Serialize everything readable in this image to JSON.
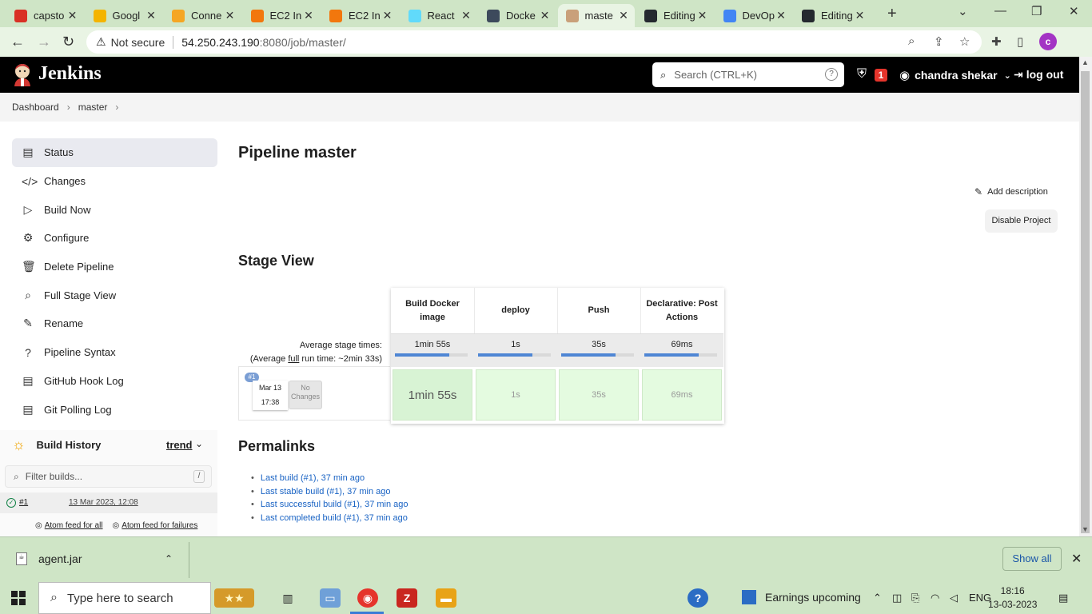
{
  "browser": {
    "tabs": [
      {
        "title": "capsto",
        "color": "#d93025",
        "letter": "M"
      },
      {
        "title": "Googl",
        "color": "#f4b400",
        "letter": ""
      },
      {
        "title": "Conne",
        "color": "#f5a623",
        "letter": ""
      },
      {
        "title": "EC2 In",
        "color": "#f2770d",
        "letter": ""
      },
      {
        "title": "EC2 In",
        "color": "#f2770d",
        "letter": ""
      },
      {
        "title": "React",
        "color": "#61dafb",
        "letter": ""
      },
      {
        "title": "Docke",
        "color": "#3d4a5c",
        "letter": ""
      },
      {
        "title": "maste",
        "color": "#c9a07a",
        "letter": ""
      },
      {
        "title": "Editing",
        "color": "#24292f",
        "letter": ""
      },
      {
        "title": "DevOp",
        "color": "#4285f4",
        "letter": ""
      },
      {
        "title": "Editing",
        "color": "#24292f",
        "letter": ""
      }
    ],
    "not_secure": "Not secure",
    "url_host": "54.250.243.190",
    "url_rest": ":8080/job/master/",
    "profile_letter": "c"
  },
  "jenkins": {
    "brand": "Jenkins",
    "search_placeholder": "Search (CTRL+K)",
    "security_count": "1",
    "user": "chandra shekar",
    "logout": "log out"
  },
  "breadcrumb": [
    "Dashboard",
    "master"
  ],
  "sidebar": {
    "items": [
      {
        "label": "Status",
        "icon": "file-icon"
      },
      {
        "label": "Changes",
        "icon": "code-icon"
      },
      {
        "label": "Build Now",
        "icon": "play-icon"
      },
      {
        "label": "Configure",
        "icon": "gear-icon"
      },
      {
        "label": "Delete Pipeline",
        "icon": "trash-icon"
      },
      {
        "label": "Full Stage View",
        "icon": "search-icon"
      },
      {
        "label": "Rename",
        "icon": "pencil-icon"
      },
      {
        "label": "Pipeline Syntax",
        "icon": "help-icon"
      },
      {
        "label": "GitHub Hook Log",
        "icon": "file-icon"
      },
      {
        "label": "Git Polling Log",
        "icon": "file-icon"
      }
    ]
  },
  "build_history": {
    "title": "Build History",
    "trend": "trend",
    "filter_placeholder": "Filter builds...",
    "filter_shortcut": "/",
    "builds": [
      {
        "num": "#1",
        "date": "13 Mar 2023, 12:08"
      }
    ],
    "feed_all": "Atom feed for all",
    "feed_failures": "Atom feed for failures"
  },
  "main": {
    "title": "Pipeline master",
    "add_description": "Add description",
    "disable_project": "Disable Project",
    "stage_view_title": "Stage View",
    "avg_stage_times": "Average stage times:",
    "avg_full_prefix": "(Average ",
    "avg_full_link": "full",
    "avg_full_suffix": " run time: ~2min 33s)",
    "run_badge": "#1",
    "run_date": "Mar 13",
    "run_time": "17:38",
    "no_changes_1": "No",
    "no_changes_2": "Changes",
    "stages": [
      {
        "name": "Build Docker image",
        "avg": "1min 55s",
        "cell": "1min 55s",
        "bar_fraction": 0.75
      },
      {
        "name": "deploy",
        "avg": "1s",
        "cell": "1s",
        "bar_fraction": 0.75
      },
      {
        "name": "Push",
        "avg": "35s",
        "cell": "35s",
        "bar_fraction": 0.75
      },
      {
        "name": "Declarative: Post Actions",
        "avg": "69ms",
        "cell": "69ms",
        "bar_fraction": 0.75
      }
    ],
    "permalinks_title": "Permalinks",
    "permalinks": [
      "Last build (#1), 37 min ago",
      "Last stable build (#1), 37 min ago",
      "Last successful build (#1), 37 min ago",
      "Last completed build (#1), 37 min ago"
    ]
  },
  "downloads": {
    "file": "agent.jar",
    "show_all": "Show all"
  },
  "taskbar": {
    "search_placeholder": "Type here to search",
    "news": "Earnings upcoming",
    "lang": "ENG",
    "time": "18:16",
    "date": "13-03-2023"
  }
}
